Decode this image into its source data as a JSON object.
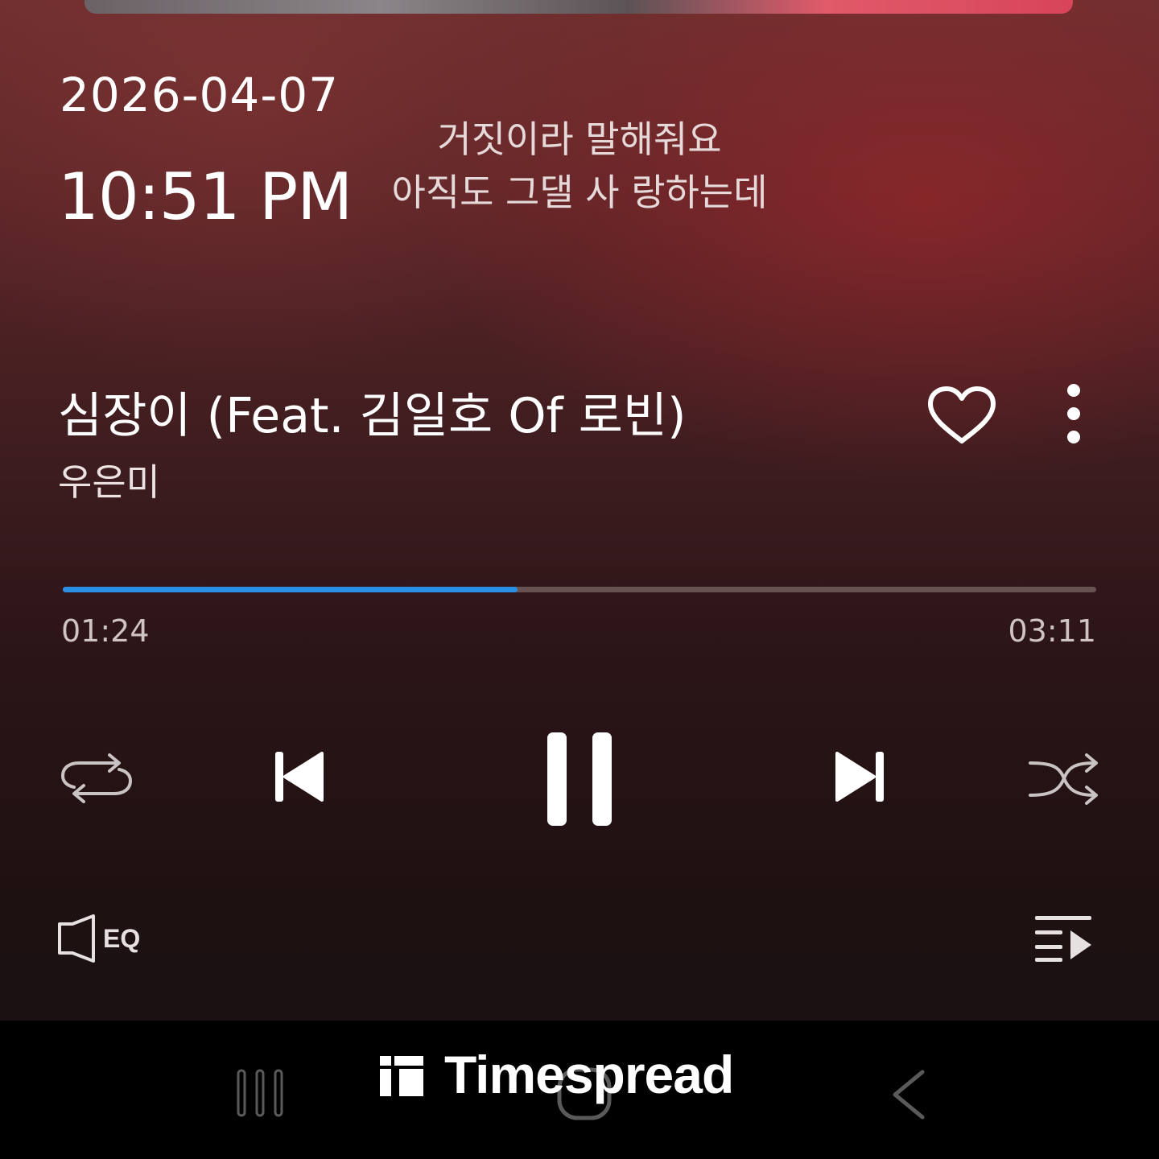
{
  "lockscreen": {
    "date": "2026-04-07",
    "time": "10:51 PM"
  },
  "lyrics": {
    "line1": "거짓이라 말해줘요",
    "line2": "아직도 그댈 사 랑하는데"
  },
  "track": {
    "title": "심장이 (Feat. 김일호 Of 로빈)",
    "artist": "우은미",
    "liked": false
  },
  "playback": {
    "elapsed": "01:24",
    "duration": "03:11",
    "progress_fraction": 0.44,
    "state": "playing",
    "accent_color": "#2b8fe6"
  },
  "controls": {
    "repeat": "repeat-icon",
    "previous": "skip-previous-icon",
    "pause": "pause-icon",
    "next": "skip-next-icon",
    "shuffle": "shuffle-icon"
  },
  "bottom": {
    "eq_label": "EQ",
    "queue": "queue-icon"
  },
  "watermark": {
    "text": "Timespread"
  }
}
